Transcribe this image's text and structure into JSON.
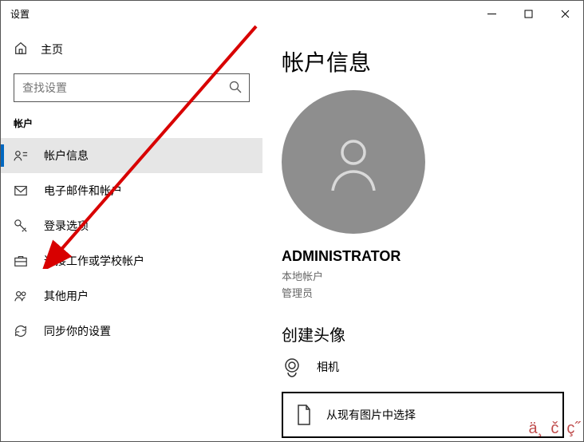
{
  "window": {
    "title": "设置"
  },
  "home": {
    "label": "主页"
  },
  "search": {
    "placeholder": "查找设置"
  },
  "section": {
    "label": "帐户"
  },
  "nav": {
    "items": [
      {
        "label": "帐户信息"
      },
      {
        "label": "电子邮件和帐户"
      },
      {
        "label": "登录选项"
      },
      {
        "label": "连接工作或学校帐户"
      },
      {
        "label": "其他用户"
      },
      {
        "label": "同步你的设置"
      }
    ]
  },
  "main": {
    "title": "帐户信息",
    "username": "ADMINISTRATOR",
    "acct_type": "本地帐户",
    "acct_role": "管理员",
    "create_avatar": "创建头像",
    "camera": "相机",
    "browse": "从现有图片中选择"
  },
  "watermark": [
    "ä¸",
    "č",
    "ç˝"
  ]
}
